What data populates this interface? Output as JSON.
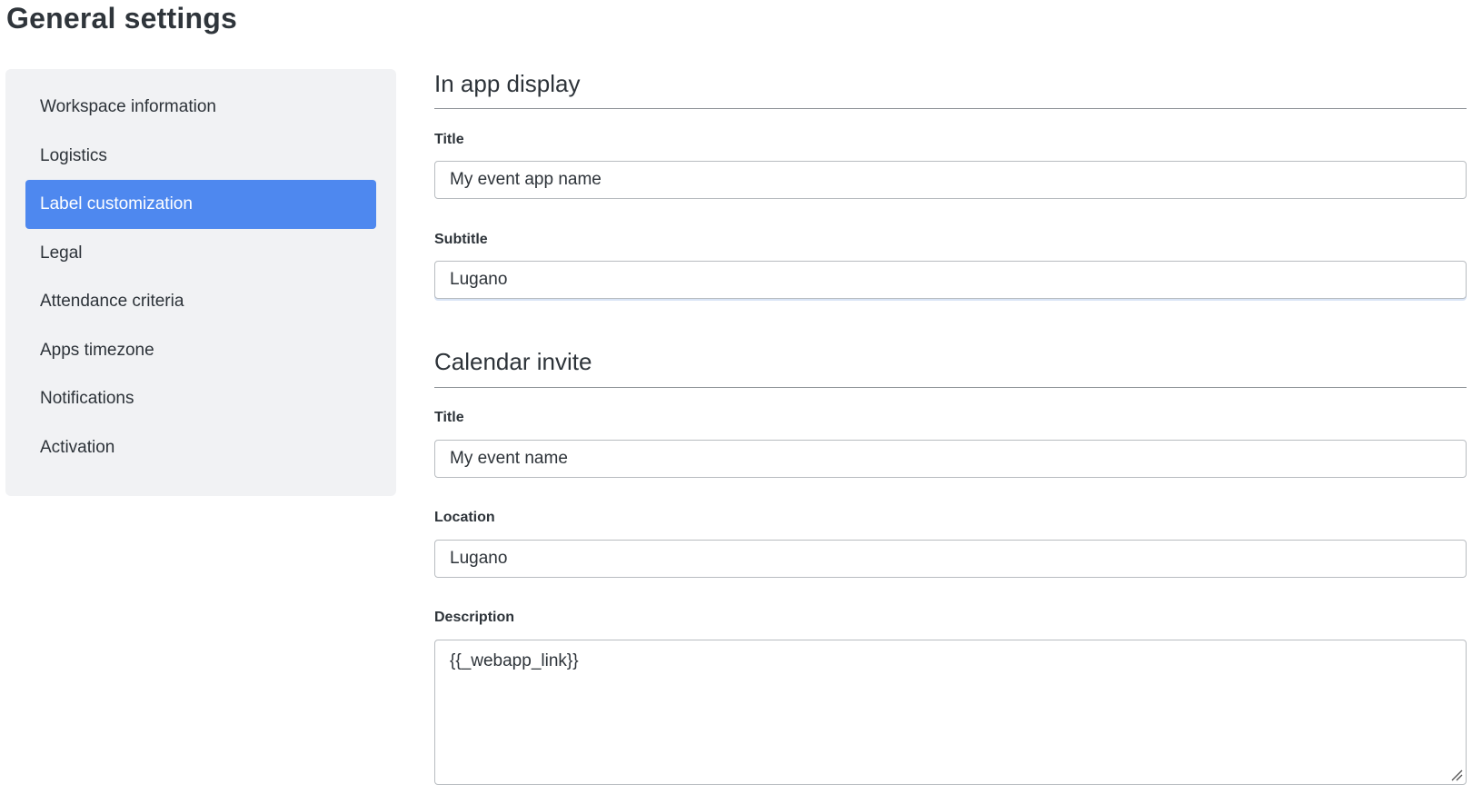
{
  "page": {
    "title": "General settings"
  },
  "sidebar": {
    "items": [
      {
        "label": "Workspace information",
        "active": false
      },
      {
        "label": "Logistics",
        "active": false
      },
      {
        "label": "Label customization",
        "active": true
      },
      {
        "label": "Legal",
        "active": false
      },
      {
        "label": "Attendance criteria",
        "active": false
      },
      {
        "label": "Apps timezone",
        "active": false
      },
      {
        "label": "Notifications",
        "active": false
      },
      {
        "label": "Activation",
        "active": false
      }
    ]
  },
  "in_app_display": {
    "heading": "In app display",
    "title_label": "Title",
    "title_value": "My event app name",
    "subtitle_label": "Subtitle",
    "subtitle_value": "Lugano"
  },
  "calendar_invite": {
    "heading": "Calendar invite",
    "title_label": "Title",
    "title_value": "My event name",
    "location_label": "Location",
    "location_value": "Lugano",
    "description_label": "Description",
    "description_value": "{{_webapp_link}}"
  },
  "colors": {
    "accent": "#4e88ef",
    "sidebar_bg": "#f1f2f4",
    "text": "#2d3339"
  }
}
